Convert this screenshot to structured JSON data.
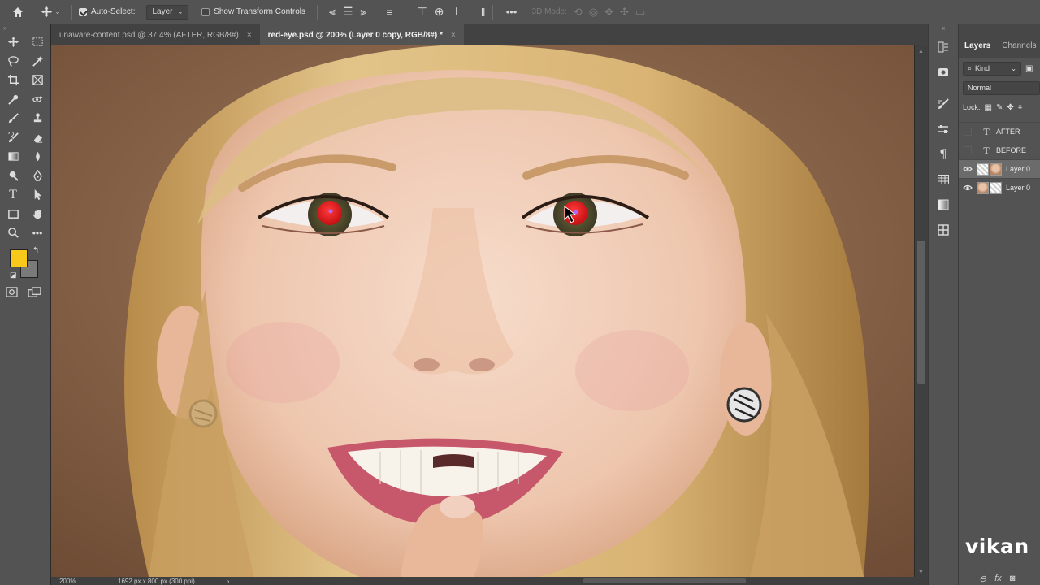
{
  "options_bar": {
    "auto_select_label": "Auto-Select:",
    "auto_select_checked": true,
    "auto_select_target": "Layer",
    "show_transform_label": "Show Transform Controls",
    "show_transform_checked": false,
    "three_d_mode_label": "3D Mode:",
    "more_label": "•••"
  },
  "tabs": [
    {
      "label": "unaware-content.psd @ 37.4% (AFTER, RGB/8#)",
      "close": "×",
      "active": false
    },
    {
      "label": "red-eye.psd @ 200% (Layer 0 copy, RGB/8#) *",
      "close": "×",
      "active": true
    }
  ],
  "colors": {
    "foreground": "#f8c91b",
    "background": "#7a7a7a",
    "red_eye": "#d41515"
  },
  "status_bar": {
    "zoom": "200%",
    "doc_info": "1692 px x 800 px (300 ppi)",
    "arrow": "›"
  },
  "layers_panel": {
    "tabs": [
      {
        "label": "Layers",
        "active": true
      },
      {
        "label": "Channels",
        "active": false
      }
    ],
    "filter_label": "Kind",
    "blend_mode": "Normal",
    "lock_label": "Lock:",
    "layers": [
      {
        "name": "AFTER",
        "type": "text",
        "visible": false,
        "selected": false
      },
      {
        "name": "BEFORE",
        "type": "text",
        "visible": false,
        "selected": false
      },
      {
        "name": "Layer 0",
        "type": "image",
        "visible": true,
        "selected": true
      },
      {
        "name": "Layer 0",
        "type": "image",
        "visible": true,
        "selected": false
      }
    ],
    "bottom_fx": "fx"
  },
  "watermark": "vikan",
  "icons": {
    "home": "home-icon",
    "move": "move-icon"
  }
}
